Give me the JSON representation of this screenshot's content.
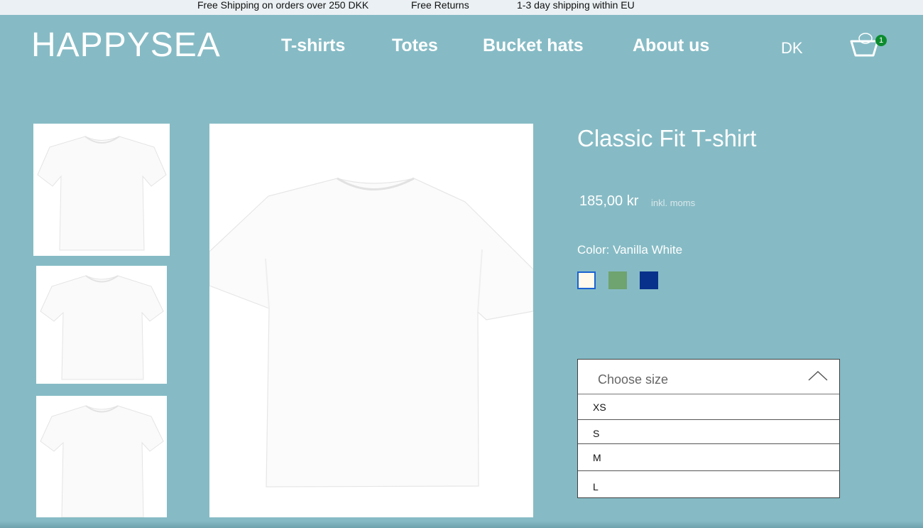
{
  "announcement_bar": {
    "items": [
      "Free Shipping on orders over 250 DKK",
      "Free Returns",
      "1-3 day shipping within EU"
    ]
  },
  "header": {
    "logo": "HAPPYSEA",
    "nav": [
      "T-shirts",
      "Totes",
      "Bucket hats",
      "About us"
    ],
    "language": "DK",
    "cart_count": "1",
    "cart_icon": "basket-icon"
  },
  "gallery": {
    "thumbnail_icons": [
      "t-shirt-image",
      "t-shirt-image",
      "t-shirt-image"
    ],
    "main_image": "t-shirt-image"
  },
  "product": {
    "title": "Classic Fit T-shirt",
    "price": "185,00 kr",
    "vat_note": "inkl. moms",
    "color_label": "Color: Vanilla White",
    "swatches": [
      {
        "name": "Vanilla White",
        "color": "#fffaeb",
        "selected": true
      },
      {
        "name": "green",
        "color": "#6fa36f",
        "selected": false
      },
      {
        "name": "navy",
        "color": "#08318c",
        "selected": false
      }
    ]
  },
  "size_selector": {
    "placeholder": "Choose size",
    "expanded": true,
    "options": [
      "XS",
      "S",
      "M",
      "L"
    ]
  },
  "colors": {
    "background": "#86bbc5",
    "announcement_background": "#eaf0f3",
    "cart_badge": "#0c8c2f",
    "selected_swatch_border": "#1b63d1"
  }
}
